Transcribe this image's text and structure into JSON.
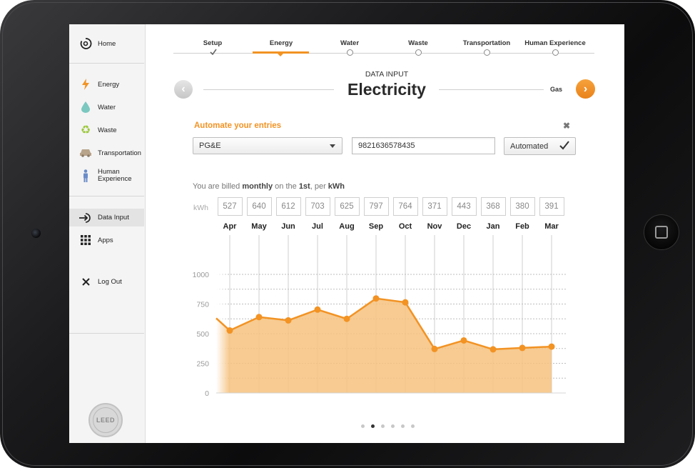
{
  "sidebar": {
    "home": {
      "label": "Home",
      "icon": "power-icon"
    },
    "items": [
      {
        "label": "Energy",
        "icon": "lightning-icon",
        "color": "#f29324"
      },
      {
        "label": "Water",
        "icon": "water-drop-icon",
        "color": "#7bc8c0"
      },
      {
        "label": "Waste",
        "icon": "recycle-icon",
        "color": "#9cc83c"
      },
      {
        "label": "Transportation",
        "icon": "car-icon",
        "color": "#b8a48a"
      },
      {
        "label": "Human Experience",
        "icon": "person-icon",
        "color": "#6a8cc8"
      }
    ],
    "data_input": {
      "label": "Data Input",
      "icon": "data-input-icon"
    },
    "apps": {
      "label": "Apps",
      "icon": "grid-icon"
    },
    "logout": {
      "label": "Log Out",
      "icon": "close-icon"
    },
    "logo_text": "LEED"
  },
  "steps": [
    {
      "label": "Setup",
      "state": "done"
    },
    {
      "label": "Energy",
      "state": "active"
    },
    {
      "label": "Water",
      "state": "pending"
    },
    {
      "label": "Waste",
      "state": "pending"
    },
    {
      "label": "Transportation",
      "state": "pending"
    },
    {
      "label": "Human Experience",
      "state": "pending"
    }
  ],
  "header": {
    "subtitle": "DATA INPUT",
    "title": "Electricity",
    "next_label": "Gas"
  },
  "automate": {
    "label": "Automate your entries",
    "utility": "PG&E",
    "account_number": "9821636578435",
    "button_label": "Automated"
  },
  "billing": {
    "prefix": "You are billed ",
    "frequency": "monthly",
    "middle": " on the ",
    "day": "1st",
    "suffix": ", per ",
    "unit": "kWh"
  },
  "kwh_label": "kWh",
  "chart_data": {
    "type": "area",
    "categories": [
      "Apr",
      "May",
      "Jun",
      "Jul",
      "Aug",
      "Sep",
      "Oct",
      "Nov",
      "Dec",
      "Jan",
      "Feb",
      "Mar"
    ],
    "values": [
      527,
      640,
      612,
      703,
      625,
      797,
      764,
      371,
      443,
      368,
      380,
      391
    ],
    "leading_value": 630,
    "ylim": [
      0,
      1000
    ],
    "yticks": [
      "0",
      "250",
      "500",
      "750",
      "1000"
    ],
    "grid": true,
    "color": "#f29324",
    "fill_color": "#f6c27f"
  },
  "pager": {
    "count": 6,
    "active": 1
  }
}
